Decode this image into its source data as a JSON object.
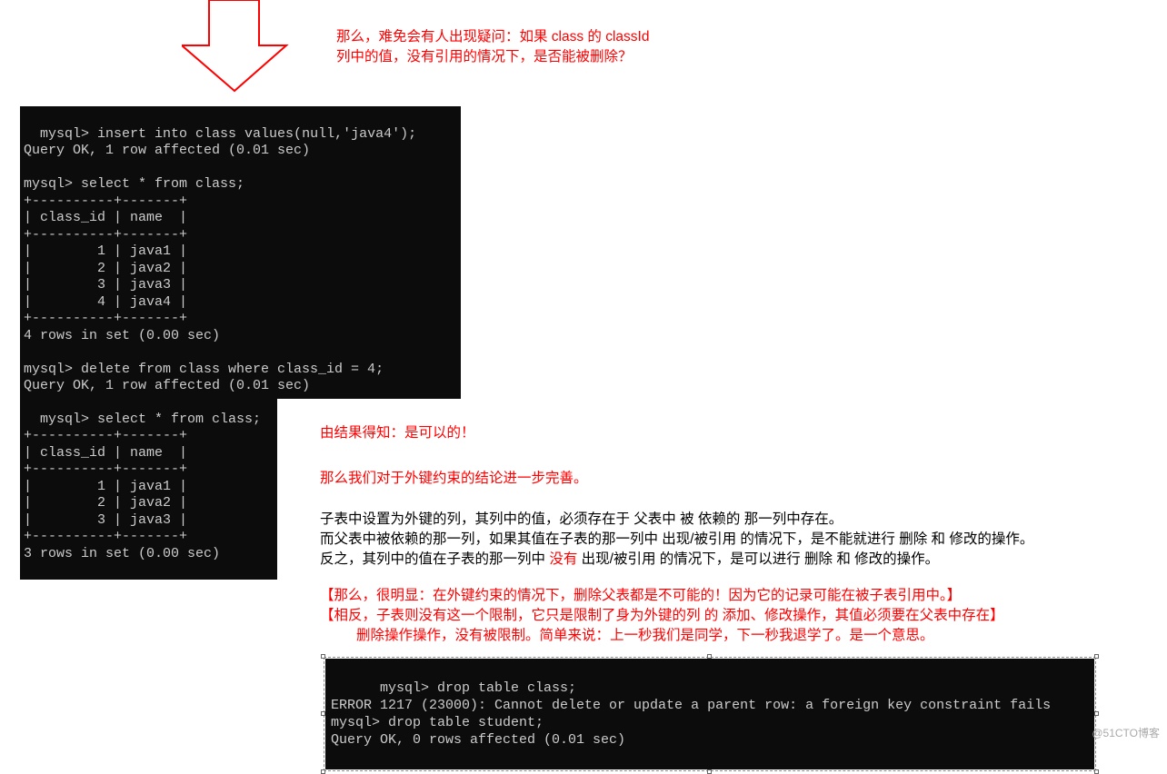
{
  "question": {
    "line1": "那么，难免会有人出现疑问：如果 class 的 classId",
    "line2": "列中的值，没有引用的情况下，是否能被删除？"
  },
  "terminal1": {
    "content": "mysql> insert into class values(null,'java4');\nQuery OK, 1 row affected (0.01 sec)\n\nmysql> select * from class;\n+----------+-------+\n| class_id | name  |\n+----------+-------+\n|        1 | java1 |\n|        2 | java2 |\n|        3 | java3 |\n|        4 | java4 |\n+----------+-------+\n4 rows in set (0.00 sec)\n\nmysql> delete from class where class_id = 4;\nQuery OK, 1 row affected (0.01 sec)"
  },
  "terminal2": {
    "content": "mysql> select * from class;\n+----------+-------+\n| class_id | name  |\n+----------+-------+\n|        1 | java1 |\n|        2 | java2 |\n|        3 | java3 |\n+----------+-------+\n3 rows in set (0.00 sec)\n\nmysql> "
  },
  "result": {
    "l1": "由结果得知：是可以的！",
    "l2": "那么我们对于外键约束的结论进一步完善。",
    "l3a": "子表中设置为外键的列，其列中的值，必须存在于  父表中  被  依赖的  那一列中存在。",
    "l3b": "而父表中被依赖的那一列，如果其值在子表的那一列中  出现/被引用  的情况下，是不能就进行  删除  和  修改的操作。",
    "l3c_pre": "反之，其列中的值在子表的那一列中 ",
    "l3c_red": "没有",
    "l3c_post": " 出现/被引用  的情况下，是可以进行  删除  和  修改的操作。",
    "l4a": "【那么，很明显：在外键约束的情况下，删除父表都是不可能的！因为它的记录可能在被子表引用中。】",
    "l4b": "【相反，子表则没有这一个限制，它只是限制了身为外键的列    的  添加、修改操作，其值必须要在父表中存在】",
    "l4c": "删除操作操作，没有被限制。简单来说：上一秒我们是同学，下一秒我退学了。是一个意思。"
  },
  "terminal3": {
    "content": "mysql> drop table class;\nERROR 1217 (23000): Cannot delete or update a parent row: a foreign key constraint fails\nmysql> drop table student;\nQuery OK, 0 rows affected (0.01 sec)"
  },
  "watermark": "@51CTO博客",
  "chart_data": {
    "type": "table",
    "tables": [
      {
        "title": "class (after insert java4)",
        "columns": [
          "class_id",
          "name"
        ],
        "rows": [
          [
            1,
            "java1"
          ],
          [
            2,
            "java2"
          ],
          [
            3,
            "java3"
          ],
          [
            4,
            "java4"
          ]
        ],
        "rows_in_set": 4,
        "time_sec": 0.0
      },
      {
        "title": "class (after delete id=4)",
        "columns": [
          "class_id",
          "name"
        ],
        "rows": [
          [
            1,
            "java1"
          ],
          [
            2,
            "java2"
          ],
          [
            3,
            "java3"
          ]
        ],
        "rows_in_set": 3,
        "time_sec": 0.0
      }
    ],
    "commands": [
      {
        "sql": "insert into class values(null,'java4');",
        "rows_affected": 1,
        "time_sec": 0.01
      },
      {
        "sql": "delete from class where class_id = 4;",
        "rows_affected": 1,
        "time_sec": 0.01
      },
      {
        "sql": "drop table class;",
        "error": "1217 (23000): Cannot delete or update a parent row: a foreign key constraint fails"
      },
      {
        "sql": "drop table student;",
        "rows_affected": 0,
        "time_sec": 0.01
      }
    ]
  }
}
